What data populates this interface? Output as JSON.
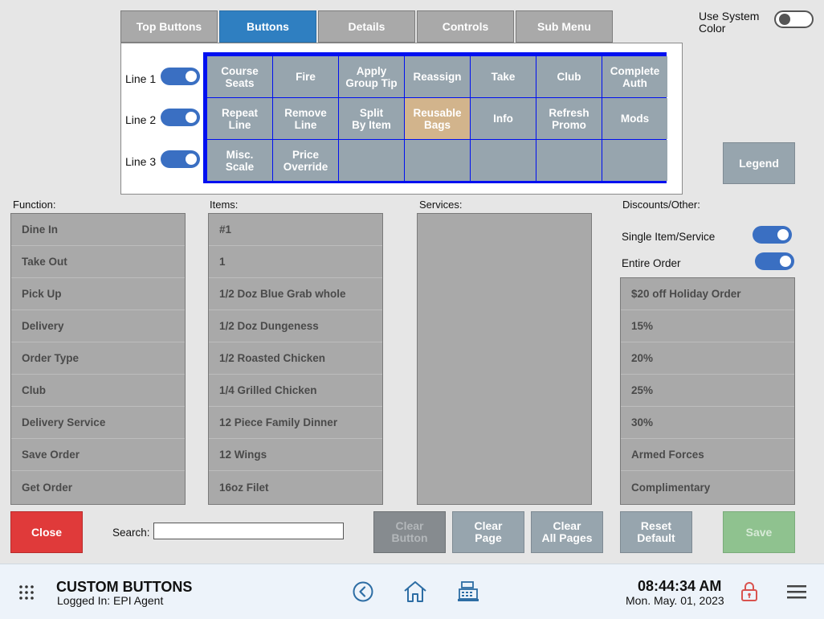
{
  "tabs": [
    "Top Buttons",
    "Buttons",
    "Details",
    "Controls",
    "Sub Menu"
  ],
  "active_tab": 1,
  "use_system_color_label": "Use System\nColor",
  "lines": [
    "Line 1",
    "Line 2",
    "Line 3"
  ],
  "grid_buttons": [
    "Course\nSeats",
    "Fire",
    "Apply\nGroup Tip",
    "Reassign",
    "Take",
    "Club",
    "Complete\nAuth",
    "Repeat\nLine",
    "Remove\nLine",
    "Split\nBy Item",
    "Reusable\nBags",
    "Info",
    "Refresh\nPromo",
    "Mods",
    "Misc.\nScale",
    "Price\nOverride",
    "",
    "",
    "",
    "",
    ""
  ],
  "legend_label": "Legend",
  "sections": {
    "function": "Function:",
    "items": "Items:",
    "services": "Services:",
    "discounts": "Discounts/Other:"
  },
  "function_items": [
    "Dine In",
    "Take Out",
    "Pick Up",
    "Delivery",
    "Order Type",
    "Club",
    "Delivery Service",
    "Save Order",
    "Get Order"
  ],
  "item_items": [
    "#1",
    "1",
    "1/2 Doz Blue Grab whole",
    "1/2 Doz Dungeness",
    "1/2 Roasted Chicken",
    "1/4 Grilled Chicken",
    "12 Piece Family Dinner",
    "12 Wings",
    "16oz Filet"
  ],
  "discount_toggles": [
    "Single Item/Service",
    "Entire Order"
  ],
  "discount_items": [
    "$20 off Holiday Order",
    "15%",
    "20%",
    "25%",
    "30%",
    "Armed Forces",
    "Complimentary"
  ],
  "bottom": {
    "close": "Close",
    "search_label": "Search:",
    "search_value": "",
    "clear_button": "Clear\nButton",
    "clear_page": "Clear\nPage",
    "clear_all_pages": "Clear\nAll Pages",
    "reset_default": "Reset\nDefault",
    "save": "Save"
  },
  "footer": {
    "title": "CUSTOM BUTTONS",
    "logged_in": "Logged In:  EPI Agent",
    "time": "08:44:34 AM",
    "date": "Mon. May. 01, 2023"
  },
  "colors": {
    "accent": "#2f7fc1",
    "grid_border": "#0010f0",
    "close": "#e03a3a",
    "save_disabled": "#8fc28f"
  }
}
